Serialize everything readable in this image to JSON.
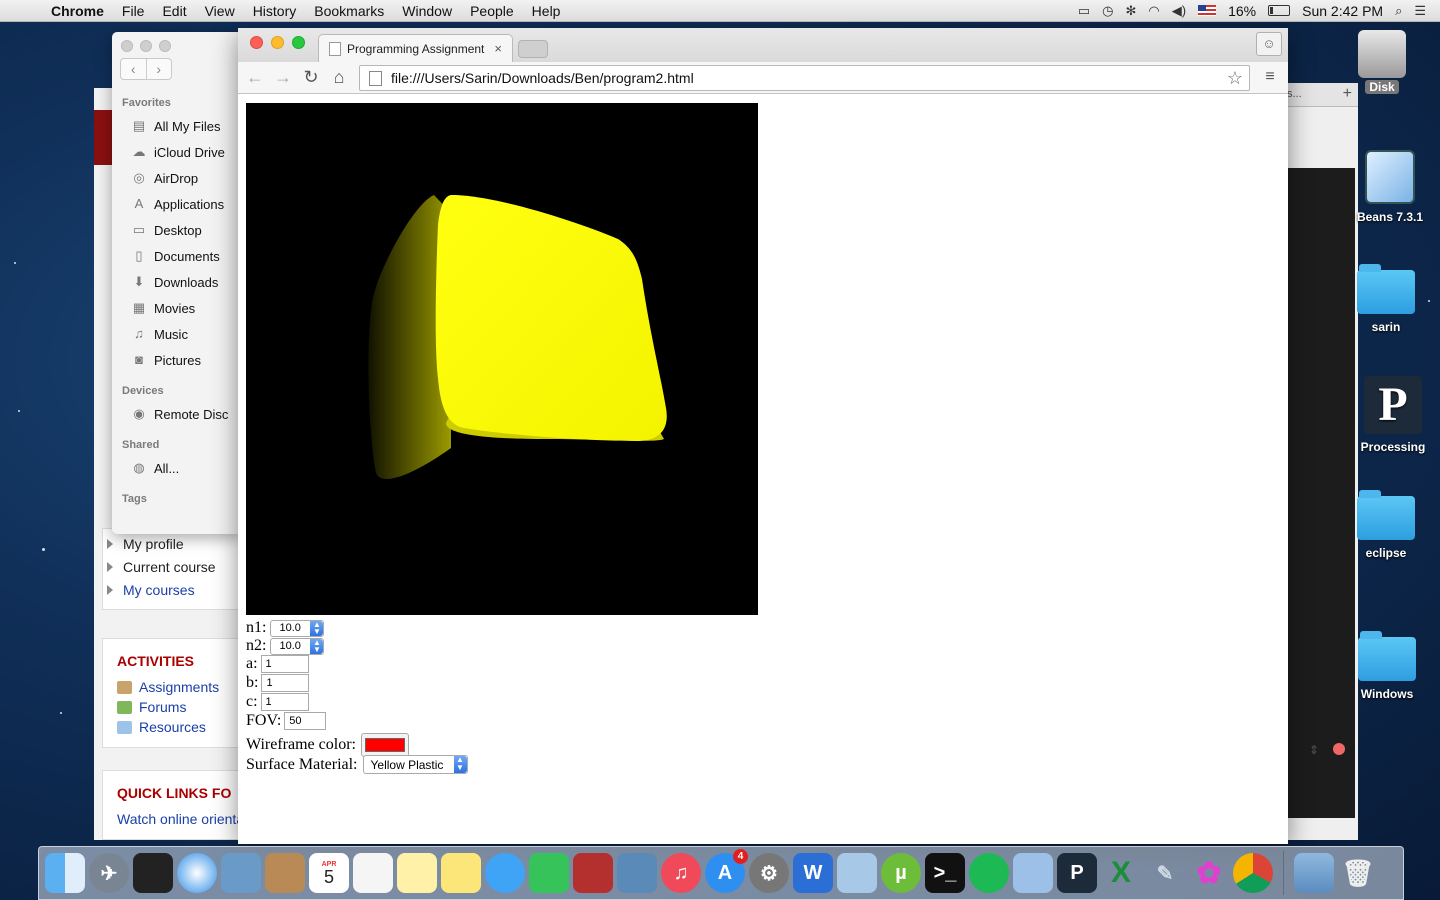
{
  "menubar": {
    "app": "Chrome",
    "menus": [
      "File",
      "Edit",
      "View",
      "History",
      "Bookmarks",
      "Window",
      "People",
      "Help"
    ],
    "battery": "16%",
    "clock": "Sun 2:42 PM"
  },
  "finder": {
    "favorites_label": "Favorites",
    "favorites": [
      {
        "label": "All My Files",
        "icon": "all-files-icon"
      },
      {
        "label": "iCloud Drive",
        "icon": "cloud-icon"
      },
      {
        "label": "AirDrop",
        "icon": "airdrop-icon"
      },
      {
        "label": "Applications",
        "icon": "applications-icon"
      },
      {
        "label": "Desktop",
        "icon": "desktop-icon"
      },
      {
        "label": "Documents",
        "icon": "documents-icon"
      },
      {
        "label": "Downloads",
        "icon": "downloads-icon"
      },
      {
        "label": "Movies",
        "icon": "movies-icon"
      },
      {
        "label": "Music",
        "icon": "music-icon"
      },
      {
        "label": "Pictures",
        "icon": "pictures-icon"
      }
    ],
    "devices_label": "Devices",
    "devices": [
      {
        "label": "Remote Disc",
        "icon": "remote-disc-icon"
      }
    ],
    "shared_label": "Shared",
    "shared": [
      {
        "label": "All...",
        "icon": "network-icon"
      }
    ],
    "tags_label": "Tags"
  },
  "moodle": {
    "nav": [
      "My profile",
      "Current course",
      "My courses"
    ],
    "activities_title": "ACTIVITIES",
    "activities": [
      {
        "label": "Assignments",
        "color": "#c9a36b"
      },
      {
        "label": "Forums",
        "color": "#7fb85a"
      },
      {
        "label": "Resources",
        "color": "#9ec3e8"
      }
    ],
    "quicklinks_title": "QUICK LINKS FO",
    "quicklinks_link": "Watch online orienta"
  },
  "rightwin": {
    "tab_text": "s..."
  },
  "chrome": {
    "tab_title": "Programming Assignment",
    "tab_close": "×",
    "url": "file:///Users/Sarin/Downloads/Ben/program2.html"
  },
  "form": {
    "n1_label": "n1:",
    "n1_value": "10.0",
    "n2_label": "n2:",
    "n2_value": "10.0",
    "a_label": "a:",
    "a_value": "1",
    "b_label": "b:",
    "b_value": "1",
    "c_label": "c:",
    "c_value": "1",
    "fov_label": "FOV:",
    "fov_value": "50",
    "wire_label": "Wireframe color:",
    "wire_color": "#ff0000",
    "surface_label": "Surface Material:",
    "surface_value": "Yellow Plastic"
  },
  "desktop": {
    "disk_label": "Disk",
    "icons": [
      "Beans 7.3.1",
      "sarin",
      "Processing",
      "eclipse",
      "Windows"
    ]
  },
  "dock": {
    "calendar_day": "5",
    "calendar_month": "APR",
    "appstore_badge": "4",
    "apps": [
      "Finder",
      "Launchpad",
      "Photo Booth",
      "Safari",
      "Preview",
      "Contacts",
      "Calendar",
      "Reminders",
      "Notes",
      "Stickies",
      "Messages",
      "FaceTime",
      "Photo Booth 2",
      "iPhoto",
      "iTunes",
      "App Store",
      "System Preferences",
      "Word",
      "NetBeans",
      "uTorrent",
      "Terminal",
      "Spotify",
      "TextEdit",
      "Processing",
      "Excel",
      "Pencil",
      "Flower",
      "Chrome",
      "Applications",
      "Trash"
    ]
  },
  "colors": {
    "shape": "#ffff00",
    "canvas_bg": "#000000",
    "moodle_red": "#8a1010",
    "link_blue": "#1a3fa8"
  }
}
